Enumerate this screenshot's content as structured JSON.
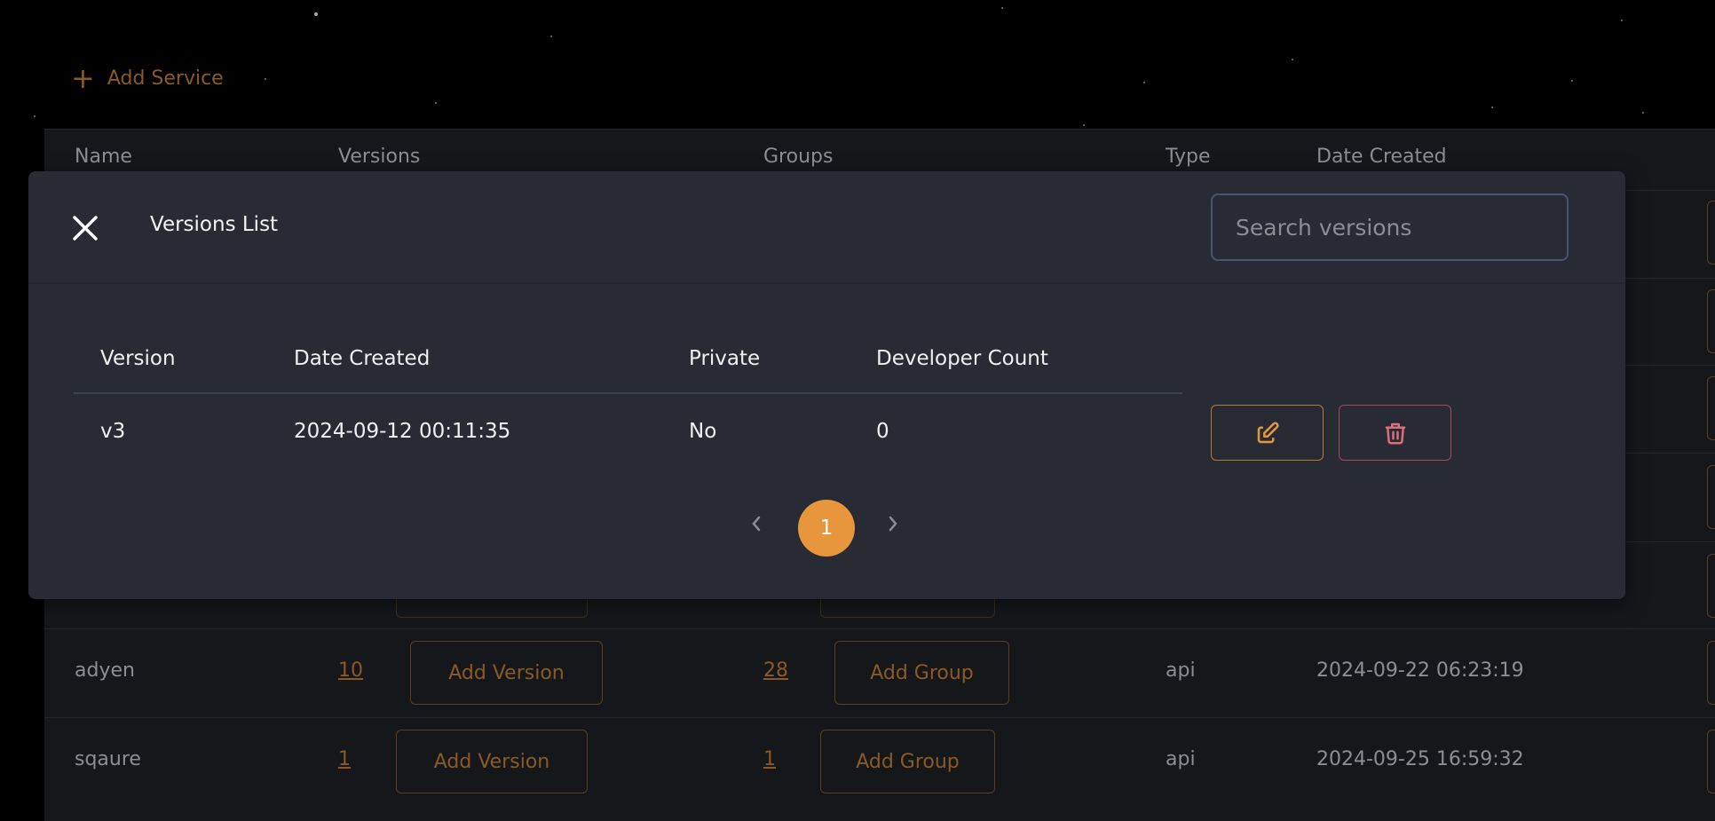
{
  "toolbar": {
    "add_service_label": "Add Service"
  },
  "services_table": {
    "headers": [
      "Name",
      "Versions",
      "Groups",
      "Type",
      "Date Created"
    ],
    "rows": [
      {
        "name": "adyen",
        "versions": "10",
        "add_version": "Add Version",
        "groups": "28",
        "add_group": "Add Group",
        "type": "api",
        "date_created": "2024-09-22 06:23:19"
      },
      {
        "name": "sqaure",
        "versions": "1",
        "add_version": "Add Version",
        "groups": "1",
        "add_group": "Add Group",
        "type": "api",
        "date_created": "2024-09-25 16:59:32"
      }
    ]
  },
  "modal": {
    "title": "Versions List",
    "search_placeholder": "Search versions",
    "headers": [
      "Version",
      "Date Created",
      "Private",
      "Developer Count"
    ],
    "rows": [
      {
        "version": "v3",
        "date_created": "2024-09-12 00:11:35",
        "private": "No",
        "developer_count": "0"
      }
    ],
    "pagination": {
      "current_page": "1"
    }
  },
  "colors": {
    "accent": "#e8963c",
    "danger": "#d9707c",
    "modal_bg": "#282b34",
    "panel_bg": "#15171b"
  },
  "icons": {
    "close": "close-icon",
    "edit": "edit-icon",
    "delete": "trash-icon",
    "add": "plus-icon"
  }
}
